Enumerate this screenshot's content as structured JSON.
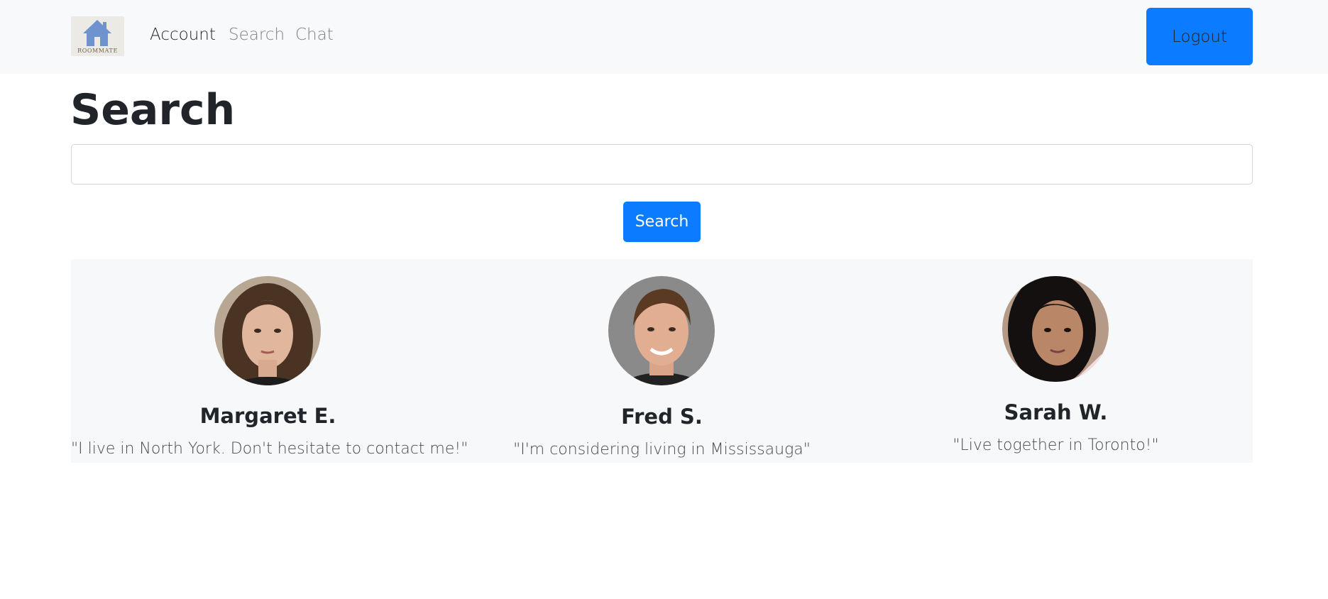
{
  "navbar": {
    "logo_text": "ROOMMATE",
    "links": [
      {
        "label": "Account",
        "active": true
      },
      {
        "label": "Search",
        "active": false
      },
      {
        "label": "Chat",
        "active": false
      }
    ],
    "logout_label": "Logout"
  },
  "page": {
    "title": "Search",
    "search_value": "",
    "search_button_label": "Search"
  },
  "results": [
    {
      "name": "Margaret E.",
      "quote": "\"I live in North York. Don't hesitate to contact me!\"",
      "avatar_icon": "avatar-photo"
    },
    {
      "name": "Fred S.",
      "quote": "\"I'm considering living in Mississauga\"",
      "avatar_icon": "avatar-photo"
    },
    {
      "name": "Sarah W.",
      "quote": "\"Live together in Toronto!\"",
      "avatar_icon": "avatar-photo"
    }
  ],
  "colors": {
    "primary": "#0b7bff",
    "navbar_bg": "#f8f9fa",
    "results_bg": "#f7f8f9"
  }
}
